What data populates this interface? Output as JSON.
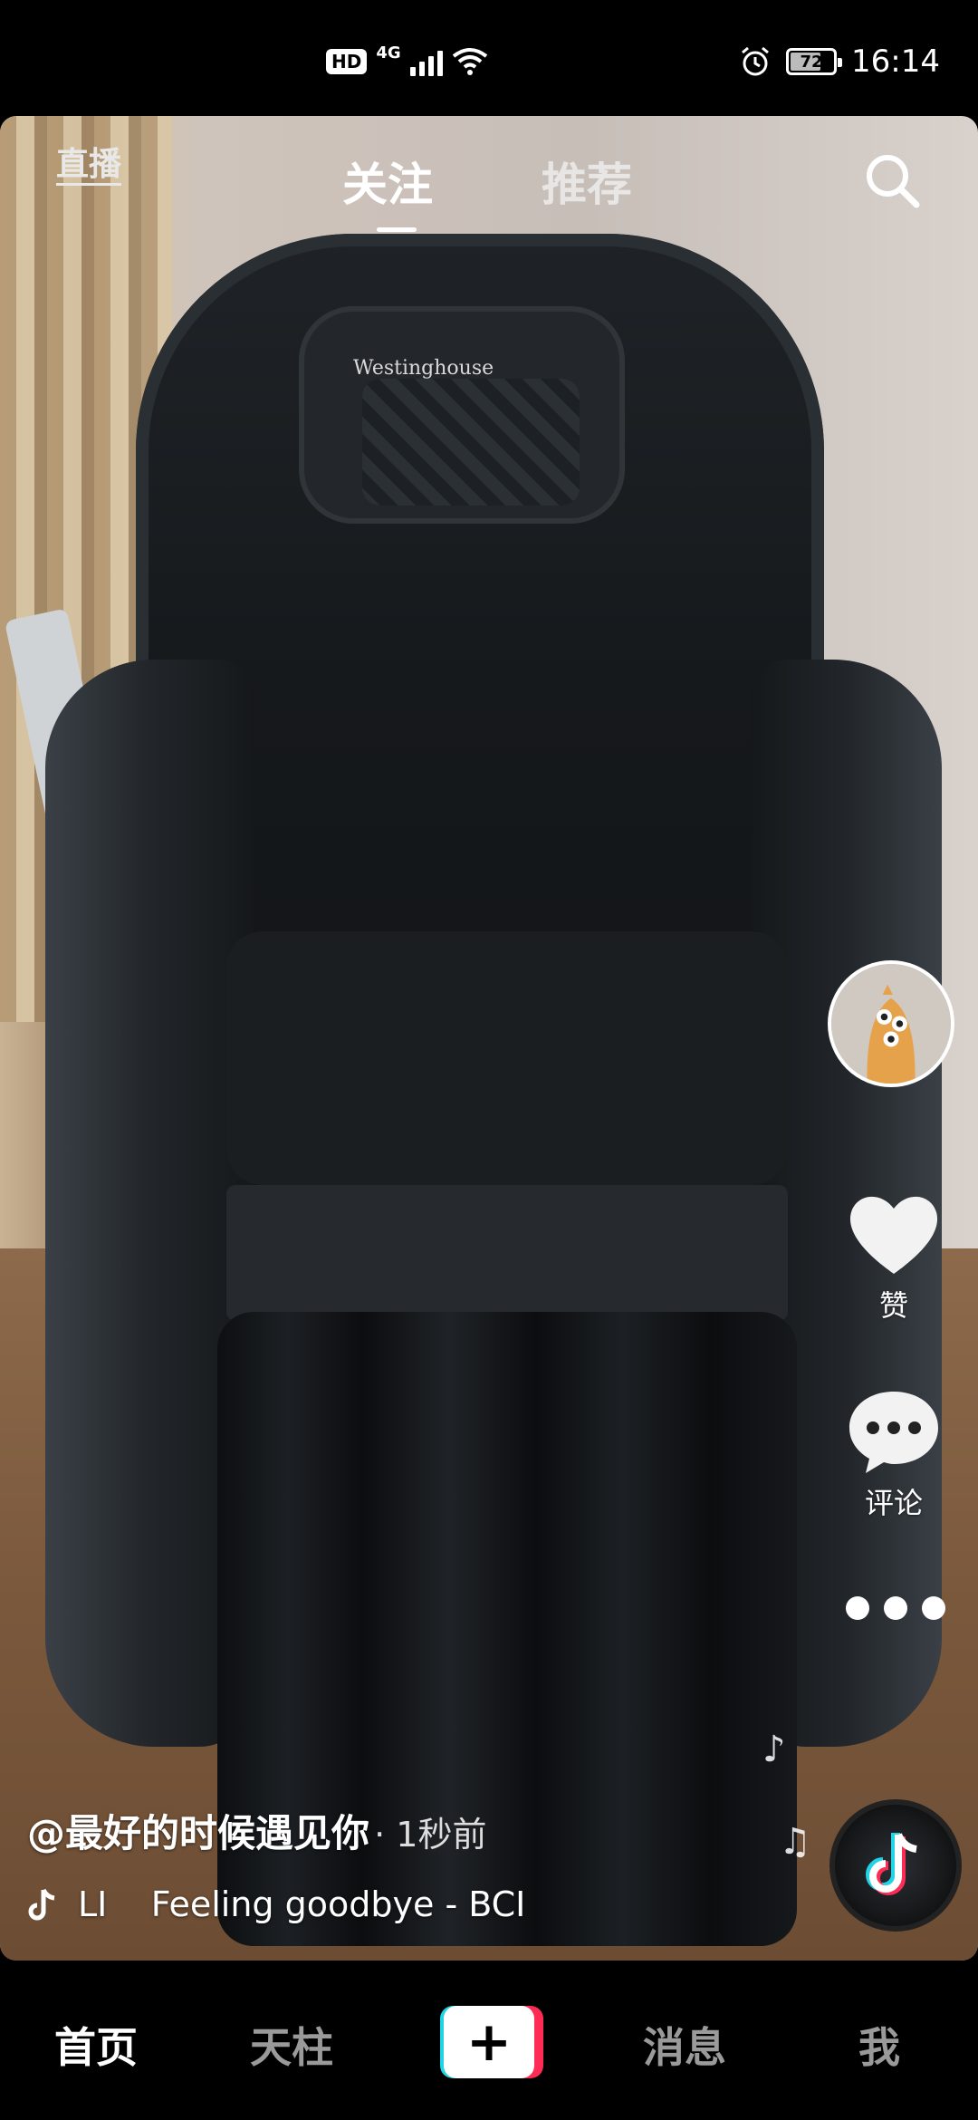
{
  "status_bar": {
    "hd": "HD",
    "network": "4G",
    "battery_level": "72",
    "battery_fraction": 0.72,
    "time": "16:14"
  },
  "top_tabs": {
    "live": "直播",
    "follow": "关注",
    "recommend": "推荐",
    "active": "follow"
  },
  "video": {
    "brand_text": "Westinghouse"
  },
  "side_actions": {
    "like_label": "赞",
    "comment_label": "评论"
  },
  "caption": {
    "author": "@最好的时候遇见你",
    "time_ago": "· 1秒前"
  },
  "music": {
    "title": "LI    Feeling goodbye - BCI"
  },
  "bottom_nav": {
    "home": "首页",
    "tianzhu": "天柱",
    "plus": "+",
    "messages": "消息",
    "me": "我",
    "active": "home"
  },
  "colors": {
    "accent_red": "#fe2c55",
    "accent_cyan": "#22d3e6",
    "background": "#000000"
  }
}
